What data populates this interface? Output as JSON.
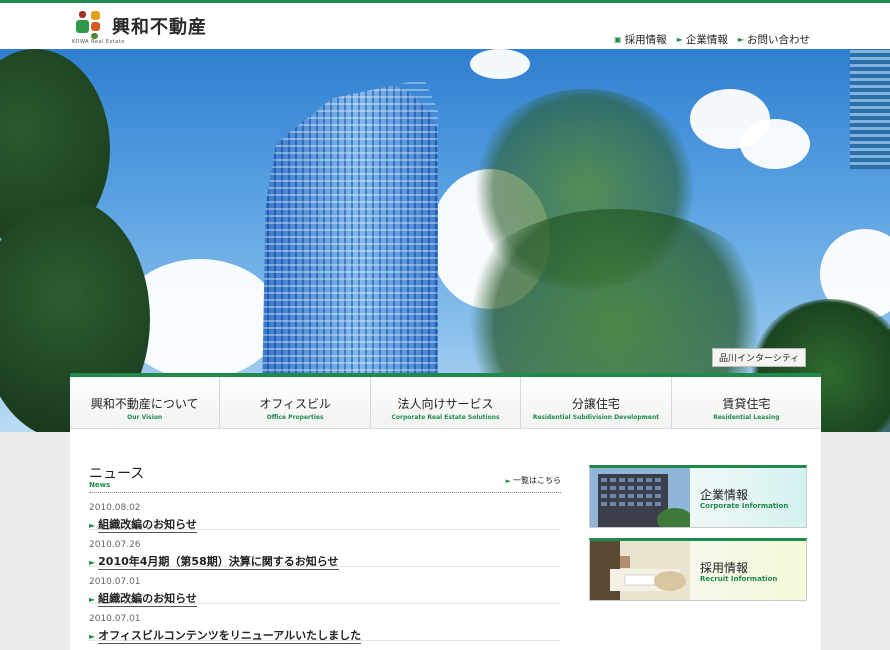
{
  "brand": {
    "name": "興和不動産",
    "sub": "KOWA Real Estate",
    "accent": "#1f8a4c"
  },
  "util_nav": [
    {
      "label": "採用情報",
      "icon": "document-icon"
    },
    {
      "label": "企業情報",
      "icon": "arrow-right-icon"
    },
    {
      "label": "お問い合わせ",
      "icon": "arrow-right-icon"
    }
  ],
  "hero": {
    "caption": "品川インターシティ"
  },
  "global_nav": [
    {
      "jp": "興和不動産について",
      "en": "Our Vision"
    },
    {
      "jp": "オフィスビル",
      "en": "Office Properties"
    },
    {
      "jp": "法人向けサービス",
      "en": "Corporate Real Estate Solutions"
    },
    {
      "jp": "分譲住宅",
      "en": "Residential Subdivision Development"
    },
    {
      "jp": "賃貸住宅",
      "en": "Residential Leasing"
    }
  ],
  "news": {
    "title": "ニュース",
    "title_en": "News",
    "more": "一覧はこちら",
    "items": [
      {
        "date": "2010.08.02",
        "title": "組織改編のお知らせ"
      },
      {
        "date": "2010.07.26",
        "title": "2010年4月期（第58期）決算に関するお知らせ"
      },
      {
        "date": "2010.07.01",
        "title": "組織改編のお知らせ"
      },
      {
        "date": "2010.07.01",
        "title": "オフィスビルコンテンツをリニューアルいたしました"
      }
    ]
  },
  "banners": [
    {
      "jp": "企業情報",
      "en": "Corporate Information"
    },
    {
      "jp": "採用情報",
      "en": "Recruit Information"
    }
  ]
}
